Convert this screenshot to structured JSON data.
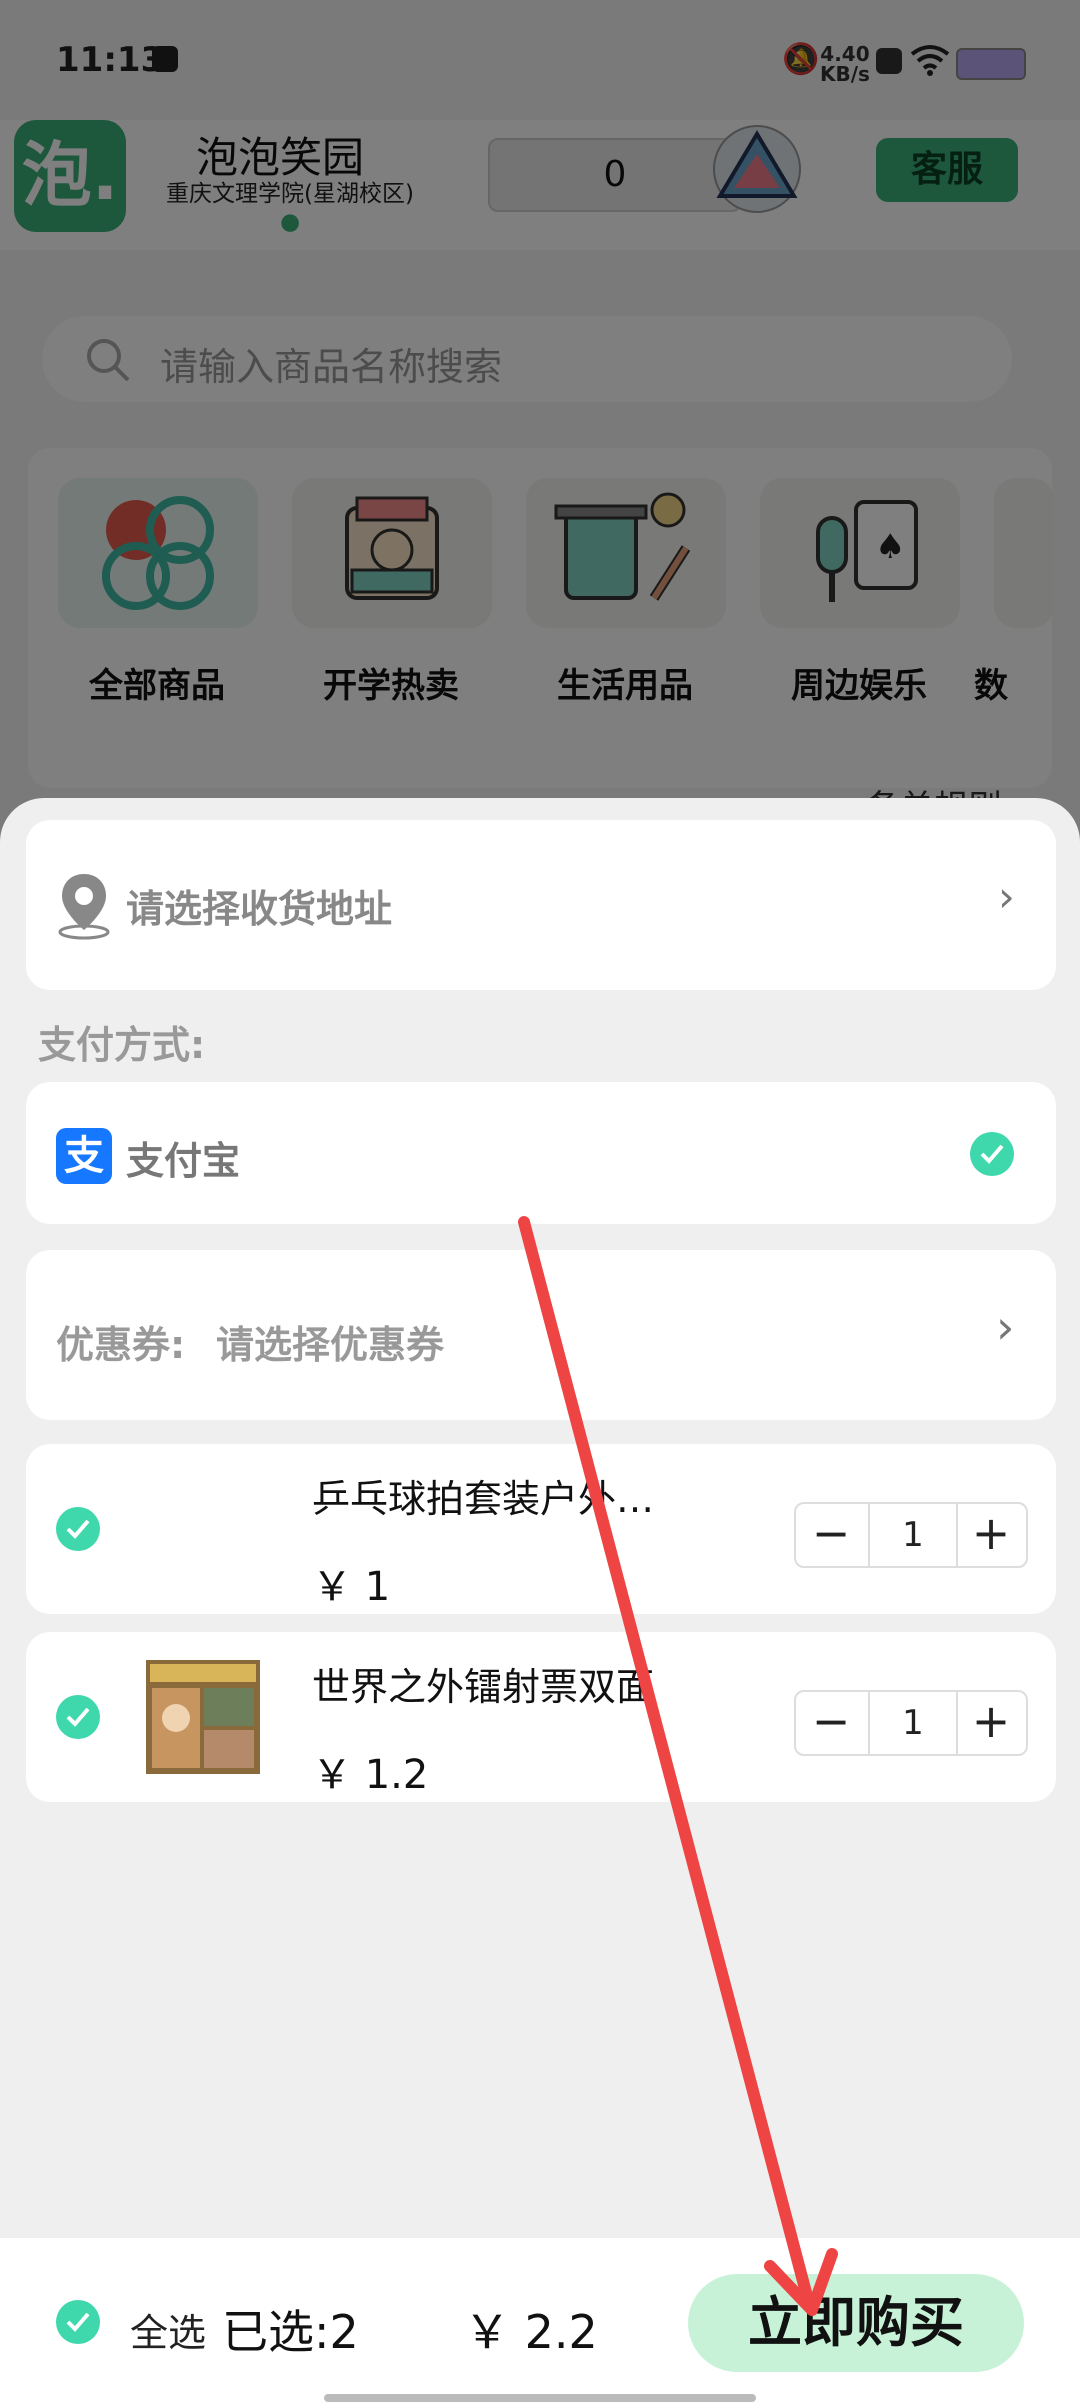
{
  "status_bar": {
    "time": "11:13",
    "net_speed": "4.40",
    "net_unit": "KB/s"
  },
  "header": {
    "logo_text": "泡.",
    "shop_name": "泡泡笑园",
    "campus": "重庆文理学院(星湖校区)",
    "badge_count": "0",
    "service_button": "客服"
  },
  "search": {
    "placeholder": "请输入商品名称搜索"
  },
  "categories": [
    {
      "label": "全部商品"
    },
    {
      "label": "开学热卖"
    },
    {
      "label": "生活用品"
    },
    {
      "label": "周边娱乐"
    },
    {
      "label": "数"
    }
  ],
  "background_link": "备单规则",
  "checkout": {
    "address_placeholder": "请选择收货地址",
    "payment_title": "支付方式:",
    "payment_icon_text": "支",
    "payment_method": "支付宝",
    "coupon_label": "优惠券:",
    "coupon_placeholder": "请选择优惠券",
    "items": [
      {
        "name": "乒乓球拍套装户外…",
        "price": "￥ 1",
        "qty": "1",
        "checked": true
      },
      {
        "name": "世界之外镭射票双面",
        "price": "￥ 1.2",
        "qty": "1",
        "checked": true
      }
    ],
    "stepper_minus": "−",
    "stepper_plus": "+"
  },
  "footer": {
    "select_all": "全选",
    "selected_count": "已选:2",
    "total": "￥ 2.2",
    "buy_button": "立即购买"
  },
  "colors": {
    "brand_green": "#3ab07a",
    "check_teal": "#3fd8ad",
    "buy_bg": "#c8f2d8",
    "annotation_arrow": "#ee4444"
  }
}
